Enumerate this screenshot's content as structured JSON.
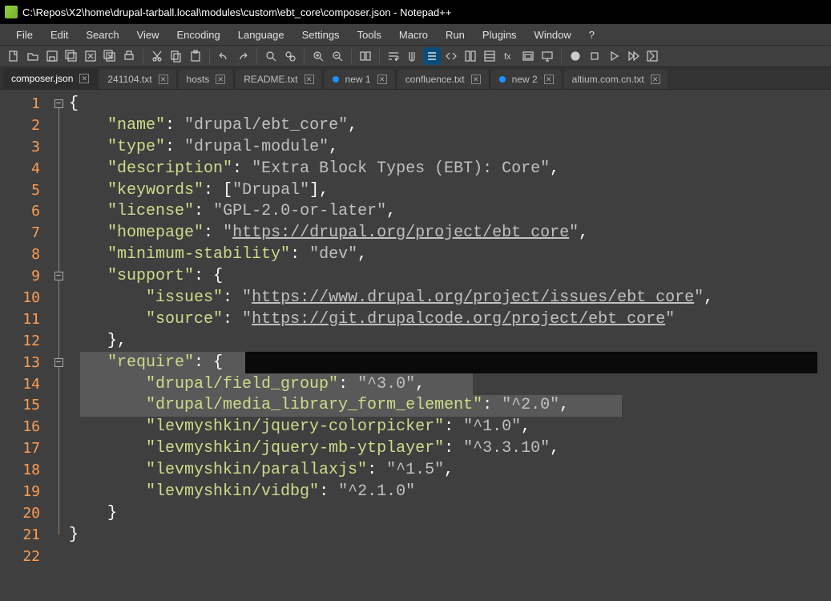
{
  "titlebar": {
    "text": "C:\\Repos\\X2\\home\\drupal-tarball.local\\modules\\custom\\ebt_core\\composer.json - Notepad++"
  },
  "menu": [
    "File",
    "Edit",
    "Search",
    "View",
    "Encoding",
    "Language",
    "Settings",
    "Tools",
    "Macro",
    "Run",
    "Plugins",
    "Window",
    "?"
  ],
  "tabs": [
    {
      "label": "composer.json",
      "active": true,
      "dirty": false
    },
    {
      "label": "241104.txt",
      "active": false,
      "dirty": false
    },
    {
      "label": "hosts",
      "active": false,
      "dirty": false
    },
    {
      "label": "README.txt",
      "active": false,
      "dirty": false
    },
    {
      "label": "new 1",
      "active": false,
      "dirty": true
    },
    {
      "label": "confluence.txt",
      "active": false,
      "dirty": false
    },
    {
      "label": "new 2",
      "active": false,
      "dirty": true
    },
    {
      "label": "altium.com.cn.txt",
      "active": false,
      "dirty": false
    }
  ],
  "lines": {
    "count": 22
  },
  "json": {
    "l1": "{",
    "name_k": "\"name\"",
    "name_v": "\"drupal/ebt_core\"",
    "type_k": "\"type\"",
    "type_v": "\"drupal-module\"",
    "desc_k": "\"description\"",
    "desc_v": "\"Extra Block Types (EBT): Core\"",
    "kw_k": "\"keywords\"",
    "kw_v": "\"Drupal\"",
    "lic_k": "\"license\"",
    "lic_v": "\"GPL-2.0-or-later\"",
    "home_k": "\"homepage\"",
    "home_v": "https://drupal.org/project/ebt_core",
    "min_k": "\"minimum-stability\"",
    "min_v": "\"dev\"",
    "sup_k": "\"support\"",
    "issues_k": "\"issues\"",
    "issues_v": "https://www.drupal.org/project/issues/ebt_core",
    "source_k": "\"source\"",
    "source_v": "https://git.drupalcode.org/project/ebt_core",
    "req_k": "\"require\"",
    "fg_k": "\"drupal/field_group\"",
    "fg_v": "\"^3.0\"",
    "mlfe_k": "\"drupal/media_library_form_element\"",
    "mlfe_v": "\"^2.0\"",
    "cp_k": "\"levmyshkin/jquery-colorpicker\"",
    "cp_v": "\"^1.0\"",
    "yt_k": "\"levmyshkin/jquery-mb-ytplayer\"",
    "yt_v": "\"^3.3.10\"",
    "px_k": "\"levmyshkin/parallaxjs\"",
    "px_v": "\"^1.5\"",
    "vb_k": "\"levmyshkin/vidbg\"",
    "vb_v": "\"^2.1.0\""
  }
}
